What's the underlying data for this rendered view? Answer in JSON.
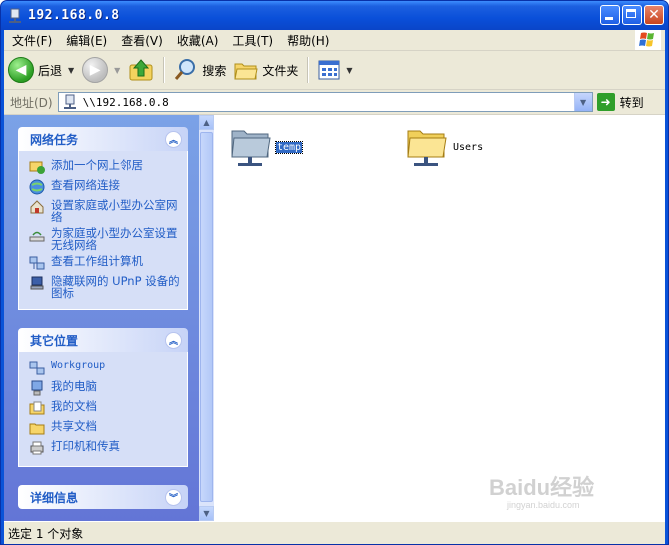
{
  "window": {
    "title": "192.168.0.8"
  },
  "menu": {
    "items": [
      "文件(F)",
      "编辑(E)",
      "查看(V)",
      "收藏(A)",
      "工具(T)",
      "帮助(H)"
    ]
  },
  "toolbar": {
    "back_label": "后退",
    "search_label": "搜索",
    "folders_label": "文件夹"
  },
  "address": {
    "label": "地址(D)",
    "value": "\\\\192.168.0.8",
    "go_label": "转到"
  },
  "taskpane": {
    "network_tasks": {
      "title": "网络任务",
      "links": [
        "添加一个网上邻居",
        "查看网络连接",
        "设置家庭或小型办公室网络",
        "为家庭或小型办公室设置无线网络",
        "查看工作组计算机",
        "隐藏联网的 UPnP 设备的图标"
      ]
    },
    "other_places": {
      "title": "其它位置",
      "links": [
        "Workgroup",
        "我的电脑",
        "我的文档",
        "共享文档",
        "打印机和传真"
      ]
    },
    "details": {
      "title": "详细信息"
    }
  },
  "files": [
    {
      "name": "temp",
      "selected": true
    },
    {
      "name": "Users",
      "selected": false
    }
  ],
  "status": {
    "text": "选定 1 个对象"
  },
  "watermark": {
    "text": "Baidu经验",
    "sub": "jingyan.baidu.com"
  }
}
